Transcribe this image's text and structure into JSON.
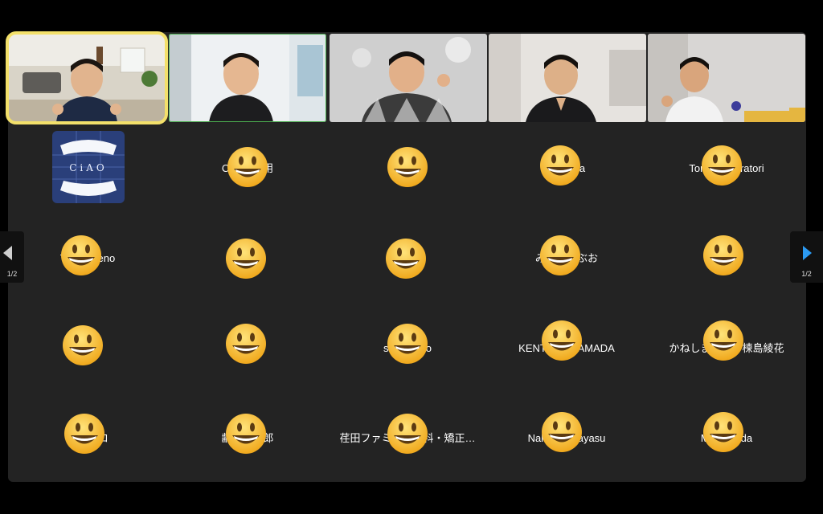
{
  "colors": {
    "panel_bg": "#232323",
    "active_speaker": "#f3e06a",
    "pinned": "#4caf50",
    "nav_arrow_active": "#2b9af3"
  },
  "video_participants": [
    {
      "id": "v1",
      "state": "active-speaker"
    },
    {
      "id": "v2",
      "state": "pinned"
    },
    {
      "id": "v3",
      "state": "normal"
    },
    {
      "id": "v4",
      "state": "normal"
    },
    {
      "id": "v5",
      "state": "normal"
    }
  ],
  "grid": [
    {
      "name": "",
      "avatar": "ciao-logo",
      "overlay": false
    },
    {
      "name": "Ci　　　用",
      "overlay": true
    },
    {
      "name": "",
      "overlay": true
    },
    {
      "name": "　　　a",
      "overlay": true
    },
    {
      "name": "Tom　　　ratori",
      "overlay": true
    },
    {
      "name": "T　　　eno",
      "overlay": true
    },
    {
      "name": "",
      "overlay": true
    },
    {
      "name": "",
      "overlay": true
    },
    {
      "name": "み　　　ぶお",
      "overlay": true
    },
    {
      "name": "",
      "overlay": true
    },
    {
      "name": "",
      "overlay": true
    },
    {
      "name": "",
      "overlay": true
    },
    {
      "name": "sa　　　o",
      "overlay": true
    },
    {
      "name": "KENT　　　AMADA",
      "overlay": true
    },
    {
      "name": "かねしま　　　楝島綾花",
      "overlay": true
    },
    {
      "name": "　　　コ",
      "overlay": true
    },
    {
      "name": "齢　　　郎",
      "overlay": true
    },
    {
      "name": "荏田ファミ　　　科・矯正…",
      "overlay": true
    },
    {
      "name": "Nak　　　ayasu",
      "overlay": true
    },
    {
      "name": "M　　　da",
      "overlay": true
    }
  ],
  "pagination": {
    "left_label": "1/2",
    "right_label": "1/2"
  }
}
